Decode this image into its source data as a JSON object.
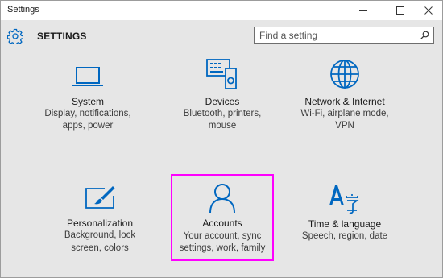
{
  "window": {
    "title": "Settings"
  },
  "header": {
    "title": "SETTINGS"
  },
  "search": {
    "placeholder": "Find a setting"
  },
  "accent_color": "#0067c0",
  "selection_color": "#ff00ff",
  "tiles": [
    {
      "title": "System",
      "desc1": "Display, notifications,",
      "desc2": "apps, power",
      "desc3": "",
      "icon": "laptop-icon"
    },
    {
      "title": "Devices",
      "desc1": "Bluetooth, printers,",
      "desc2": "mouse",
      "desc3": "",
      "icon": "devices-icon"
    },
    {
      "title": "Network & Internet",
      "desc1": "Wi-Fi, airplane mode,",
      "desc2": "VPN",
      "desc3": "",
      "icon": "globe-icon"
    },
    {
      "title": "Personalization",
      "desc1": "Background, lock",
      "desc2": "screen, colors",
      "desc3": "",
      "icon": "paintbrush-icon"
    },
    {
      "title": "Accounts",
      "desc1": "Your account, sync",
      "desc2": "settings, work, family",
      "desc3": "",
      "icon": "person-icon",
      "selected": true
    },
    {
      "title": "Time & language",
      "desc1": "Speech, region, date",
      "desc2": "",
      "desc3": "",
      "icon": "time-language-icon"
    }
  ]
}
